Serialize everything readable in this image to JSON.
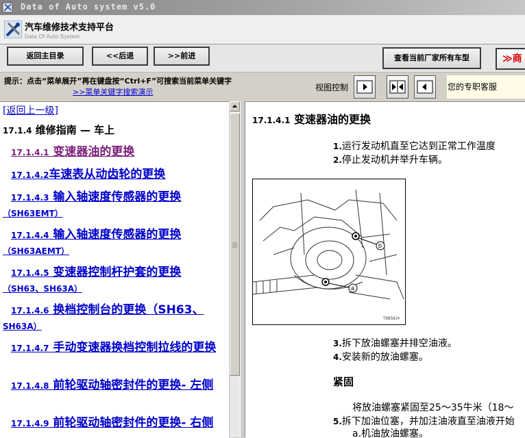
{
  "window": {
    "title": "Data of Auto system v5.0"
  },
  "header": {
    "app_name": "汽车维修技术支持平台",
    "subtitle": "Data Of Auto System"
  },
  "toolbar": {
    "home": "返回主目录",
    "back": "<<后退",
    "forward": ">>前进",
    "all_models": "查看当前厂家所有车型",
    "red_button": "≫商"
  },
  "hint": {
    "text": "提示：点击“菜单展开”再在键盘按“Ctrl+F”可搜索当前菜单关键字",
    "demo_link": ">>菜单关键字搜索演示",
    "view_control": "视图控制",
    "service": "您的专职客服"
  },
  "left": {
    "back_link": "[返回上一级]",
    "section_num": "17.1.4",
    "section_title": " 维修指南 — 车上",
    "items": [
      {
        "num": "17.1.4.1",
        "text": " 变速器油的更换"
      },
      {
        "num": "17.1.4.2",
        "text": "车速表从动齿轮的更换"
      },
      {
        "num": "17.1.4.3",
        "text": " 输入轴速度传感器的更换",
        "extra": "（SH63EMT）"
      },
      {
        "num": "17.1.4.4",
        "text": " 输入轴速度传感器的更换",
        "extra": "（SH63AEMT）"
      },
      {
        "num": "17.1.4.5",
        "text": " 变速器控制杆护套的更换",
        "extra": "（SH63、SH63A）"
      },
      {
        "num": "17.1.4.6",
        "text": " 换档控制台的更换（SH63、",
        "extra": "SH63A）"
      },
      {
        "num": "17.1.4.7",
        "text": " 手动变速器换档控制拉线的更换"
      },
      {
        "num": "17.1.4.8",
        "text": " 前轮驱动轴密封件的更换- 左侧"
      },
      {
        "num": "17.1.4.9",
        "text": " 前轮驱动轴密封件的更换- 右侧"
      }
    ]
  },
  "right": {
    "title_num": "17.1.4.1",
    "title": " 变速器油的更换",
    "steps": [
      {
        "n": "1.",
        "text": "运行发动机直至它达到正常工作温度"
      },
      {
        "n": "2.",
        "text": "停止发动机并举升车辆。"
      },
      {
        "n": "3.",
        "text": "拆下放油螺塞并排空油液。"
      },
      {
        "n": "4.",
        "text": "安装新的放油螺塞。"
      }
    ],
    "figure": {
      "code": "T8B5824",
      "callout_a": "a",
      "callout_b": "b"
    },
    "subheading": "紧固",
    "torque": "将放油螺塞紧固至25～35牛米（18～",
    "step5_n": "5.",
    "step5": "拆下加油位塞，并加注油液直至油液开始",
    "step5a": "a.机油放油螺塞。"
  }
}
